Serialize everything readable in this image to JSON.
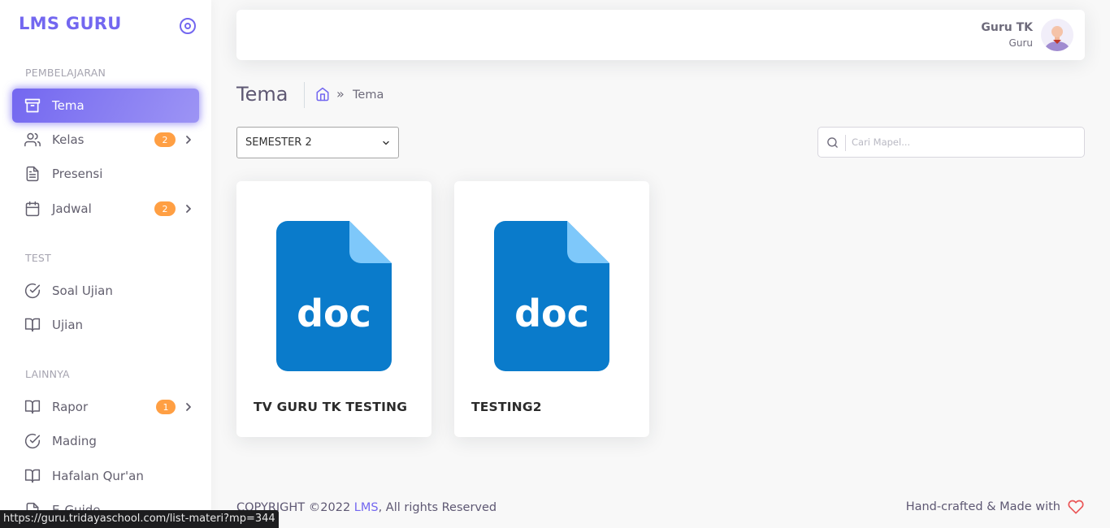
{
  "sidebar": {
    "brand": "LMS GURU",
    "sections": {
      "learning": "PEMBELAJARAN",
      "test": "TEST",
      "other": "LAINNYA"
    },
    "items": [
      {
        "label": "Tema",
        "icon": "archive-icon",
        "active": true
      },
      {
        "label": "Kelas",
        "icon": "users-icon",
        "badge": "2"
      },
      {
        "label": "Presensi",
        "icon": "file-text-icon"
      },
      {
        "label": "Jadwal",
        "icon": "calendar-icon",
        "badge": "2"
      },
      {
        "label": "Soal Ujian",
        "icon": "check-circle-icon"
      },
      {
        "label": "Ujian",
        "icon": "book-open-icon"
      },
      {
        "label": "Rapor",
        "icon": "book-open-icon",
        "badge": "1"
      },
      {
        "label": "Mading",
        "icon": "check-circle-icon"
      },
      {
        "label": "Hafalan Qur'an",
        "icon": "book-open-icon"
      },
      {
        "label": "E-Guide",
        "icon": "file-icon"
      }
    ]
  },
  "header": {
    "user_name": "Guru TK",
    "user_role": "Guru"
  },
  "page": {
    "title": "Tema",
    "breadcrumb": "Tema",
    "breadcrumb_sep": "»",
    "semester_selected": "SEMESTER 2",
    "search_placeholder": "Cari Mapel..."
  },
  "cards": [
    {
      "title": "TV GURU TK TESTING",
      "icon_text": "doc"
    },
    {
      "title": "TESTING2",
      "icon_text": "doc"
    }
  ],
  "footer": {
    "copyright": "COPYRIGHT ©2022 ",
    "brand_link": "LMS",
    "rights": ", All rights Reserved",
    "made_with": "Hand-crafted & Made with"
  },
  "status_url": "https://guru.tridayaschool.com/list-materi?mp=344",
  "colors": {
    "primary": "#7367f0",
    "badge": "#ff9f43",
    "doc_blue": "#0a7bcb",
    "doc_fold": "#7ec8fa",
    "heart": "#ea5455"
  }
}
